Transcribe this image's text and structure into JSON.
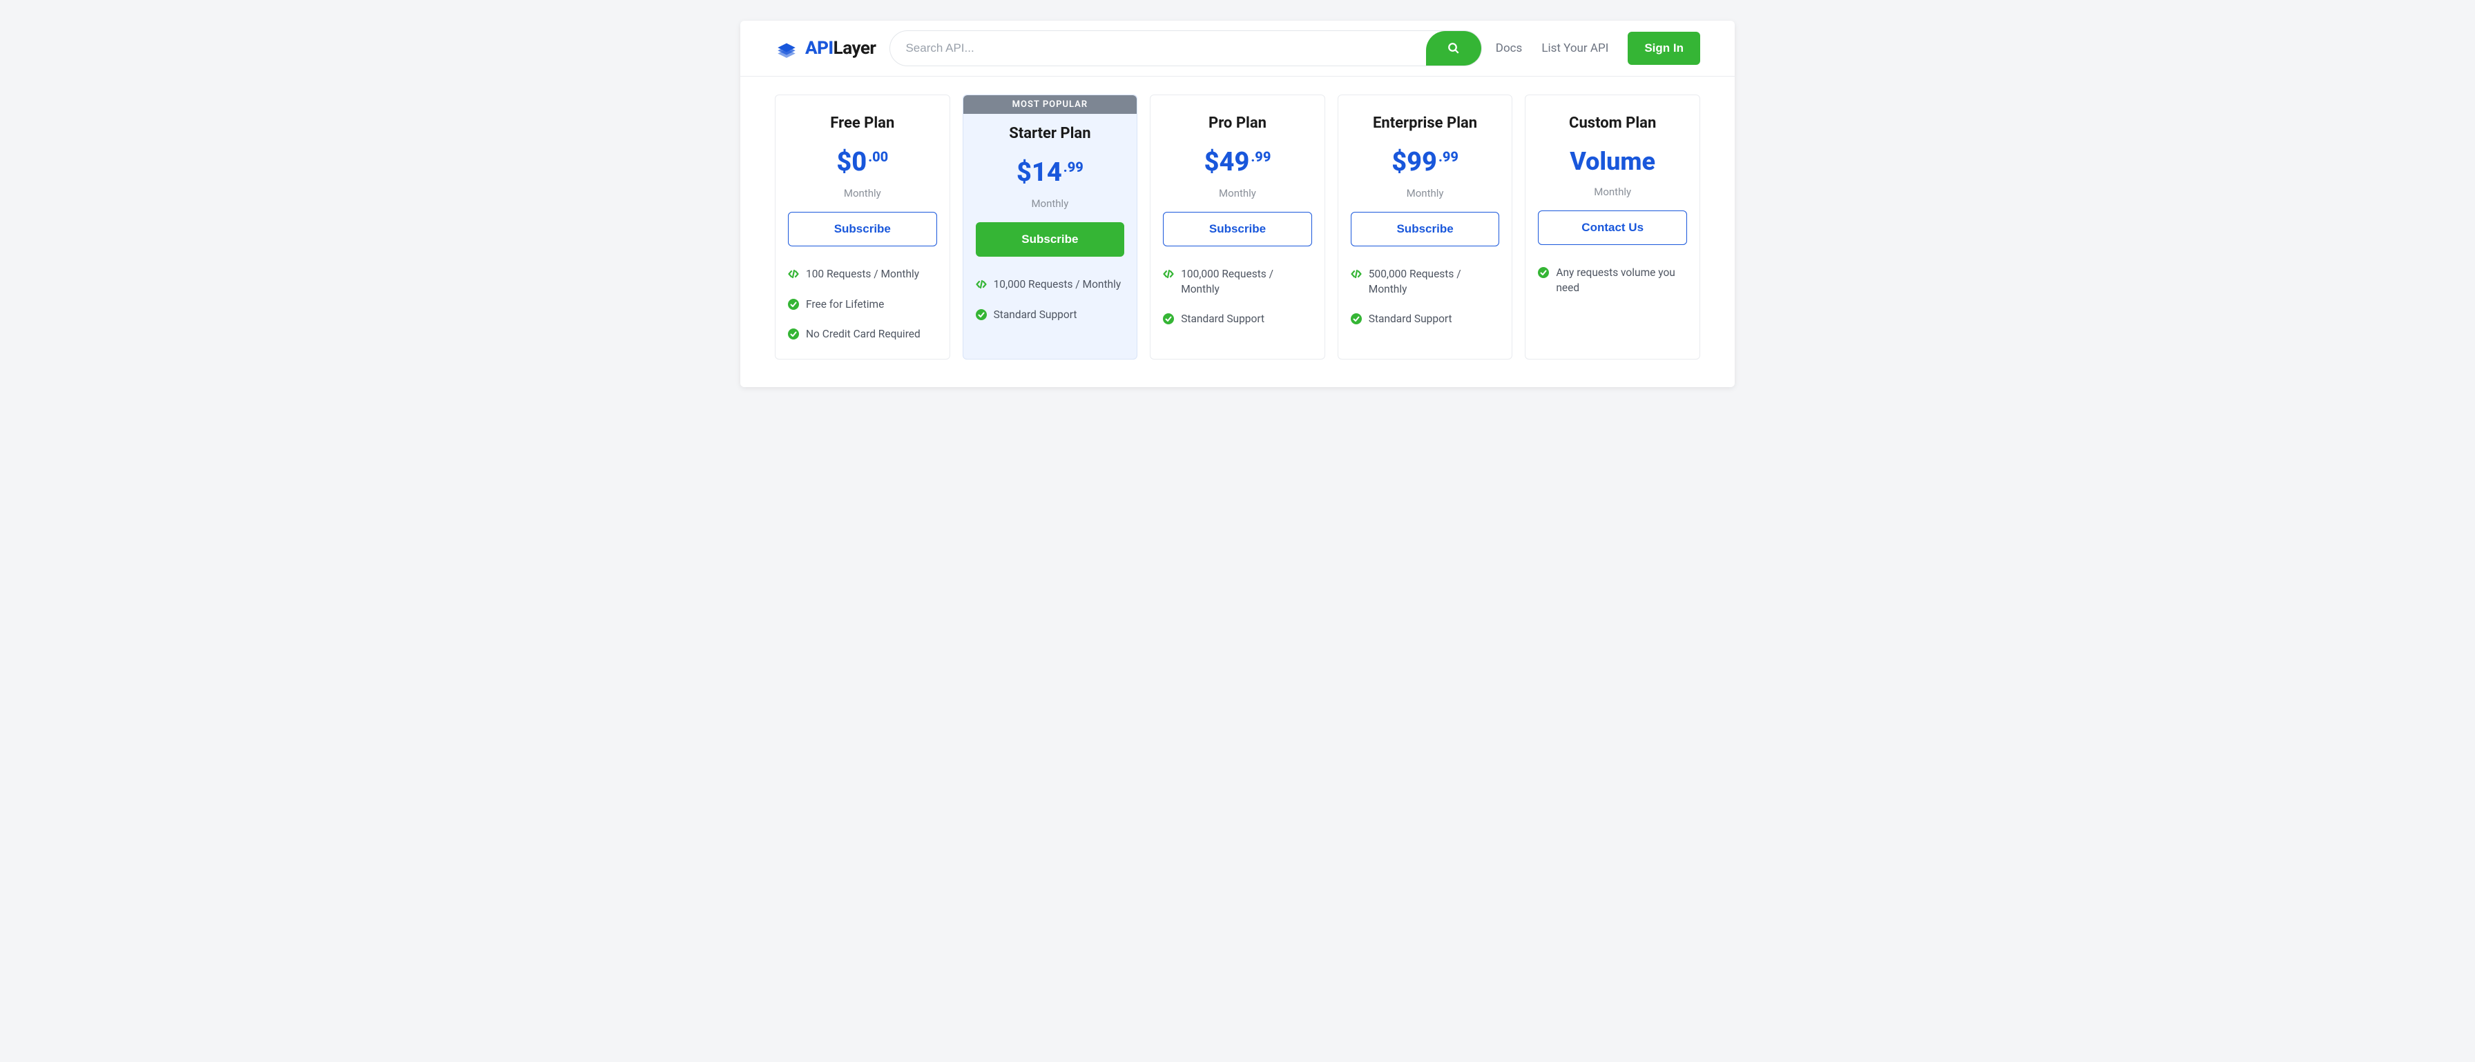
{
  "brand": {
    "primary": "API",
    "secondary": "Layer"
  },
  "search": {
    "placeholder": "Search API..."
  },
  "nav": {
    "docs": "Docs",
    "list_api": "List Your API",
    "sign_in": "Sign In"
  },
  "plans": [
    {
      "name": "Free Plan",
      "price_main": "$0",
      "price_cents": ".00",
      "period": "Monthly",
      "cta": "Subscribe",
      "popular": false,
      "features": [
        {
          "icon": "code",
          "text": "100 Requests / Monthly"
        },
        {
          "icon": "check",
          "text": "Free for Lifetime"
        },
        {
          "icon": "check",
          "text": "No Credit Card Required"
        }
      ]
    },
    {
      "name": "Starter Plan",
      "price_main": "$14",
      "price_cents": ".99",
      "period": "Monthly",
      "cta": "Subscribe",
      "popular": true,
      "badge": "MOST POPULAR",
      "features": [
        {
          "icon": "code",
          "text": "10,000 Requests / Monthly"
        },
        {
          "icon": "check",
          "text": "Standard Support"
        }
      ]
    },
    {
      "name": "Pro Plan",
      "price_main": "$49",
      "price_cents": ".99",
      "period": "Monthly",
      "cta": "Subscribe",
      "popular": false,
      "features": [
        {
          "icon": "code",
          "text": "100,000 Requests / Monthly"
        },
        {
          "icon": "check",
          "text": "Standard Support"
        }
      ]
    },
    {
      "name": "Enterprise Plan",
      "price_main": "$99",
      "price_cents": ".99",
      "period": "Monthly",
      "cta": "Subscribe",
      "popular": false,
      "features": [
        {
          "icon": "code",
          "text": "500,000 Requests / Monthly"
        },
        {
          "icon": "check",
          "text": "Standard Support"
        }
      ]
    },
    {
      "name": "Custom Plan",
      "price_volume": "Volume",
      "period": "Monthly",
      "cta": "Contact Us",
      "popular": false,
      "features": [
        {
          "icon": "check",
          "text": "Any requests volume you need"
        }
      ]
    }
  ]
}
